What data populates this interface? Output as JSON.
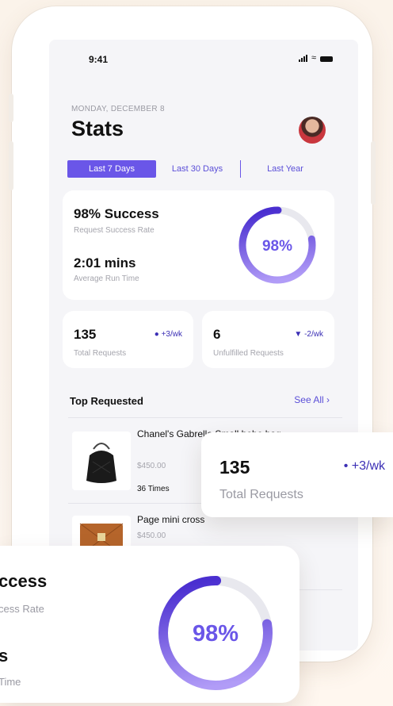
{
  "status_bar": {
    "time": "9:41"
  },
  "header": {
    "date": "MONDAY, DECEMBER 8",
    "title": "Stats"
  },
  "tabs": [
    {
      "label": "Last 7 Days",
      "active": true
    },
    {
      "label": "Last 30 Days",
      "active": false
    },
    {
      "label": "Last Year",
      "active": false
    }
  ],
  "summary": {
    "success_title": "98% Success",
    "success_sub": "Request Success Rate",
    "runtime_title": "2:01 mins",
    "runtime_sub": "Average Run Time",
    "gauge_label": "98%",
    "gauge_fraction": 0.98
  },
  "metrics": [
    {
      "value": "135",
      "delta": "+3/wk",
      "label": "Total Requests",
      "direction": "up"
    },
    {
      "value": "6",
      "delta": "-2/wk",
      "label": "Unfulfilled Requests",
      "direction": "down"
    }
  ],
  "top_requested": {
    "title": "Top Requested",
    "see_all": "See All",
    "items": [
      {
        "name": "Chanel's Gabrelle Small hobo bag",
        "price": "$450.00",
        "times": "36 Times"
      },
      {
        "name": "Page mini cross",
        "price": "$450.00"
      }
    ]
  },
  "float_metric": {
    "value": "135",
    "delta": "+3/wk",
    "label": "Total Requests"
  },
  "float_summary": {
    "success": "ccess",
    "success_sub": "cess Rate",
    "runtime": "s",
    "runtime_sub": "Time",
    "gauge_label": "98%"
  },
  "colors": {
    "accent": "#6a56e8",
    "gauge_start": "#4a2fd0",
    "gauge_end": "#b19cf7"
  }
}
